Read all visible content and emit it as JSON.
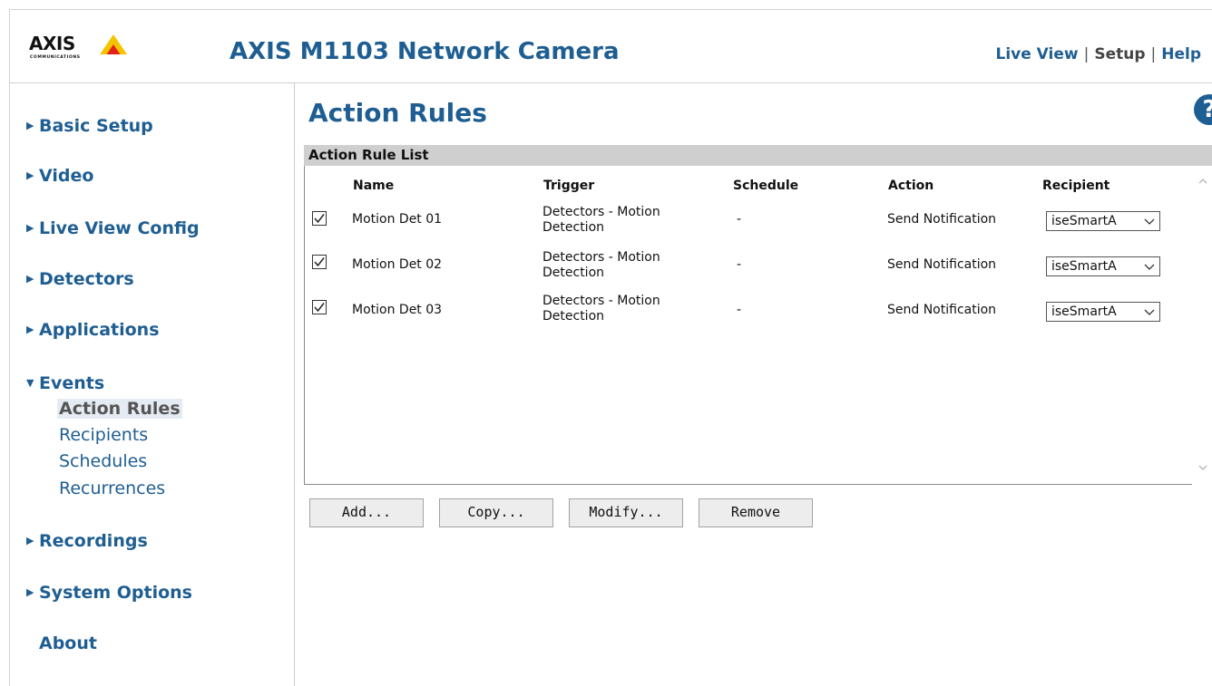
{
  "header": {
    "logo_text": "AXIS",
    "logo_sub": "COMMUNICATIONS",
    "product_title": "AXIS M1103 Network Camera",
    "nav": {
      "live_view": "Live View",
      "setup": "Setup",
      "help": "Help",
      "separator": "|"
    }
  },
  "sidebar": {
    "items": [
      {
        "label": "Basic Setup",
        "arrow": "▶"
      },
      {
        "label": "Video",
        "arrow": "▶"
      },
      {
        "label": "Live View Config",
        "arrow": "▶"
      },
      {
        "label": "Detectors",
        "arrow": "▶"
      },
      {
        "label": "Applications",
        "arrow": "▶"
      },
      {
        "label": "Events",
        "arrow": "▼"
      },
      {
        "label": "Recordings",
        "arrow": "▶"
      },
      {
        "label": "System Options",
        "arrow": "▶"
      },
      {
        "label": "About",
        "arrow": ""
      }
    ],
    "events_sub": [
      "Action Rules",
      "Recipients",
      "Schedules",
      "Recurrences"
    ]
  },
  "main": {
    "title": "Action Rules",
    "help_icon": "?",
    "list_title": "Action Rule List",
    "columns": {
      "name": "Name",
      "trigger": "Trigger",
      "schedule": "Schedule",
      "action": "Action",
      "recipient": "Recipient"
    },
    "rows": [
      {
        "checked": true,
        "name": "Motion Det 01",
        "trigger": "Detectors - Motion Detection",
        "schedule": "-",
        "action": "Send Notification",
        "recipient": "iseSmartA"
      },
      {
        "checked": true,
        "name": "Motion Det 02",
        "trigger": "Detectors - Motion Detection",
        "schedule": "-",
        "action": "Send Notification",
        "recipient": "iseSmartA"
      },
      {
        "checked": true,
        "name": "Motion Det 03",
        "trigger": "Detectors - Motion Detection",
        "schedule": "-",
        "action": "Send Notification",
        "recipient": "iseSmartA"
      }
    ],
    "buttons": {
      "add": "Add...",
      "copy": "Copy...",
      "modify": "Modify...",
      "remove": "Remove"
    }
  },
  "colors": {
    "link": "#1f5e92",
    "list_header_bg": "#cfcfcf",
    "logo_yellow": "#f5c400",
    "logo_red": "#e2231a"
  },
  "icons": {
    "help": "help-circle-icon",
    "expand": "triangle-right-icon",
    "collapse": "triangle-down-icon",
    "check": "check-icon",
    "dropdown": "chevron-down-icon"
  }
}
